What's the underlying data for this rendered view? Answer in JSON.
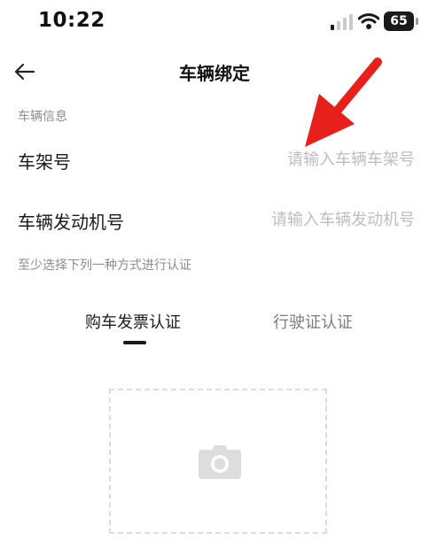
{
  "status_bar": {
    "time": "10:22",
    "battery": "65",
    "icons": [
      "signal-icon",
      "wifi-icon",
      "battery-icon"
    ]
  },
  "nav": {
    "title": "车辆绑定",
    "back_icon": "back-arrow-icon"
  },
  "vehicle_section": {
    "label": "车辆信息",
    "frame_number": {
      "label": "车架号",
      "value": "",
      "placeholder": "请输入车辆车架号"
    },
    "engine_number": {
      "label": "车辆发动机号",
      "value": "",
      "placeholder": "请输入车辆发动机号"
    }
  },
  "verify_section": {
    "label": "至少选择下列一种方式进行认证",
    "tabs": [
      {
        "label": "购车发票认证",
        "active": true
      },
      {
        "label": "行驶证认证",
        "active": false
      }
    ]
  },
  "upload": {
    "icon": "camera-icon"
  },
  "colors": {
    "annotation_arrow": "#e8201c",
    "placeholder_text": "#bdbdbd",
    "secondary_text": "#8c8c8c",
    "primary_text": "#1a1a1a",
    "dashed_border": "#dcdcdc",
    "camera_icon": "#dddddd"
  }
}
